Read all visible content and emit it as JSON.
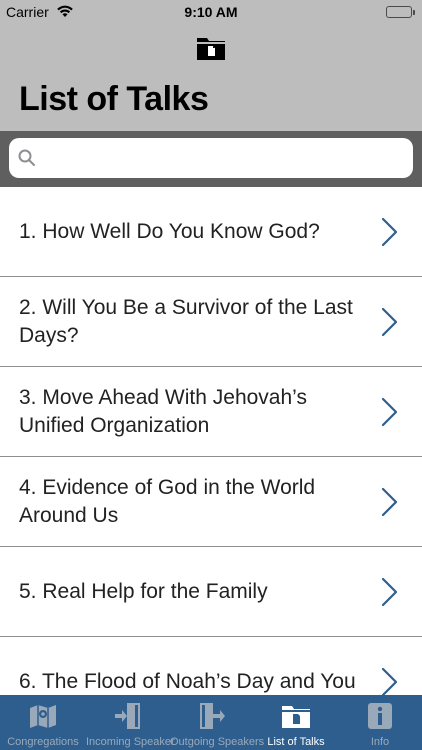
{
  "status_bar": {
    "carrier": "Carrier",
    "time": "9:10 AM",
    "battery_color": "#4cd964"
  },
  "header": {
    "icon": "folder-icon",
    "title": "List of Talks",
    "background": "#bdbdbd"
  },
  "search": {
    "placeholder": "",
    "value": "",
    "icon": "search-icon"
  },
  "talks": [
    {
      "label": "1. How Well Do You Know God?"
    },
    {
      "label": "2. Will You Be a Survivor of the Last Days?"
    },
    {
      "label": "3. Move Ahead With Jehovah’s Unified Organization"
    },
    {
      "label": "4. Evidence of God in the World Around Us"
    },
    {
      "label": "5. Real Help for the Family"
    },
    {
      "label": "6. The Flood of Noah’s Day and You"
    }
  ],
  "tab_bar": {
    "background": "#2e5e8e",
    "active_tab": "List of Talks",
    "tabs": [
      {
        "label": "Congregations",
        "icon": "map-icon"
      },
      {
        "label": "Incoming Speaker",
        "icon": "door-enter-icon"
      },
      {
        "label": "Outgoing Speakers",
        "icon": "door-exit-icon"
      },
      {
        "label": "List of Talks",
        "icon": "folder-icon"
      },
      {
        "label": "Info",
        "icon": "info-icon"
      }
    ]
  },
  "accent_color": "#2e5e8e"
}
